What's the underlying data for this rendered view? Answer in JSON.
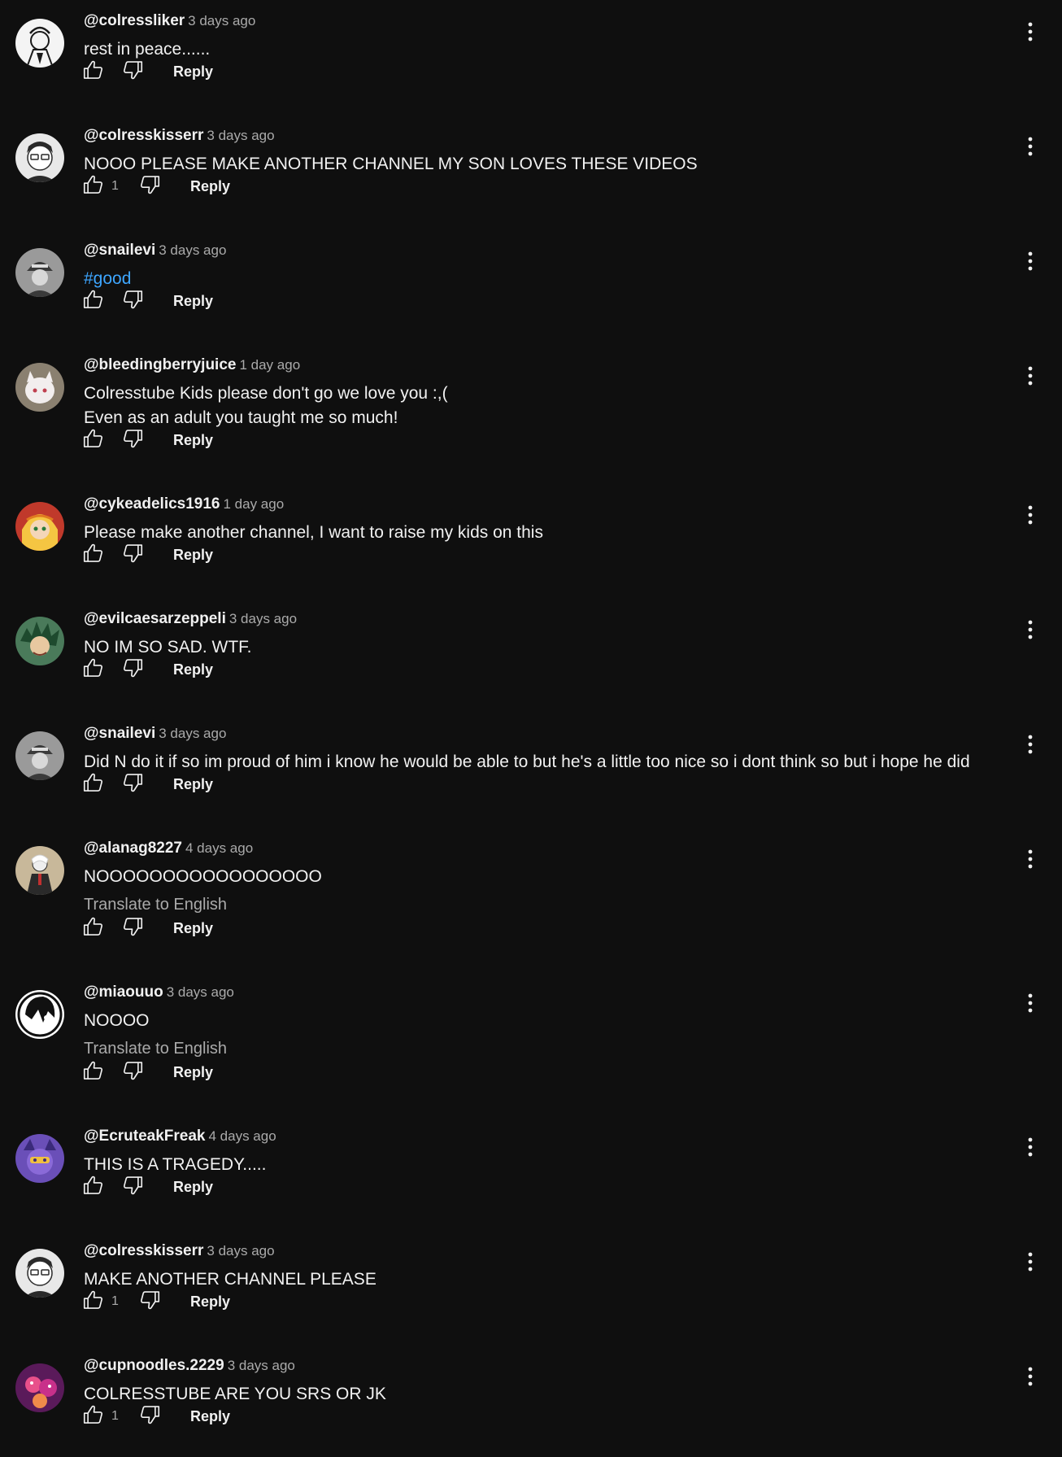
{
  "icons": {
    "like": "thumbs-up-icon",
    "dislike": "thumbs-down-icon",
    "menu": "more-vertical-icon"
  },
  "colors": {
    "background": "#0f0f0f",
    "text": "#f1f1f1",
    "secondary_text": "#aaaaaa",
    "hashtag": "#3ea6ff"
  },
  "comments": [
    {
      "author": "@colressliker",
      "time": "3 days ago",
      "lines": [
        "rest in peace......"
      ],
      "likes": "",
      "reply": "Reply",
      "avatar": {
        "bg": "#f4f4f4",
        "fg": "#1a1a1a",
        "style": "sketch"
      }
    },
    {
      "author": "@colresskisserr",
      "time": "3 days ago",
      "lines": [
        "NOOO PLEASE MAKE ANOTHER CHANNEL MY SON LOVES THESE VIDEOS"
      ],
      "likes": "1",
      "reply": "Reply",
      "avatar": {
        "bg": "#e8e8e8",
        "fg": "#2a2a2a",
        "style": "glasses"
      }
    },
    {
      "author": "@snailevi",
      "time": "3 days ago",
      "lines": [
        "#good"
      ],
      "hashtag": true,
      "likes": "",
      "reply": "Reply",
      "avatar": {
        "bg": "#9a9a9a",
        "fg": "#3a3a3a",
        "style": "cap"
      }
    },
    {
      "author": "@bleedingberryjuice",
      "time": "1 day ago",
      "lines": [
        "Colresstube Kids please don't go we love you :,(",
        "Even as an adult you taught me so much!"
      ],
      "likes": "",
      "reply": "Reply",
      "avatar": {
        "bg": "#8a8070",
        "fg": "#f2eeee",
        "style": "creature"
      }
    },
    {
      "author": "@cykeadelics1916",
      "time": "1 day ago",
      "lines": [
        "Please make another channel, I want to raise my kids on this"
      ],
      "likes": "",
      "reply": "Reply",
      "avatar": {
        "bg": "#c0392b",
        "fg": "#f5c542",
        "style": "anime"
      }
    },
    {
      "author": "@evilcaesarzeppeli",
      "time": "3 days ago",
      "lines": [
        "NO IM SO SAD. WTF."
      ],
      "likes": "",
      "reply": "Reply",
      "avatar": {
        "bg": "#4a7a5a",
        "fg": "#d8e0c0",
        "style": "spiky"
      }
    },
    {
      "author": "@snailevi",
      "time": "3 days ago",
      "lines": [
        "Did N do it if so im proud of him i know he would be able to but he's a little too nice so i dont think so but i hope he did"
      ],
      "likes": "",
      "reply": "Reply",
      "avatar": {
        "bg": "#9a9a9a",
        "fg": "#3a3a3a",
        "style": "cap"
      }
    },
    {
      "author": "@alanag8227",
      "time": "4 days ago",
      "lines": [
        "NOOOOOOOOOOOOOOOOO"
      ],
      "translate": "Translate to English",
      "likes": "",
      "reply": "Reply",
      "avatar": {
        "bg": "#c8b89a",
        "fg": "#2a2a2a",
        "style": "figure"
      }
    },
    {
      "author": "@miaouuo",
      "time": "3 days ago",
      "lines": [
        "NOOOO"
      ],
      "translate": "Translate to English",
      "likes": "",
      "reply": "Reply",
      "avatar": {
        "bg": "#ffffff",
        "fg": "#111111",
        "style": "hair"
      }
    },
    {
      "author": "@EcruteakFreak",
      "time": "4 days ago",
      "lines": [
        "THIS IS A TRAGEDY....."
      ],
      "likes": "",
      "reply": "Reply",
      "avatar": {
        "bg": "#6a4fb8",
        "fg": "#f0c040",
        "style": "mask"
      }
    },
    {
      "author": "@colresskisserr",
      "time": "3 days ago",
      "lines": [
        "MAKE ANOTHER CHANNEL PLEASE"
      ],
      "likes": "1",
      "reply": "Reply",
      "avatar": {
        "bg": "#e8e8e8",
        "fg": "#2a2a2a",
        "style": "glasses"
      }
    },
    {
      "author": "@cupnoodles.2229",
      "time": "3 days ago",
      "lines": [
        "COLRESSTUBE ARE YOU SRS OR JK"
      ],
      "likes": "1",
      "reply": "Reply",
      "avatar": {
        "bg": "#5a1a5a",
        "fg": "#e8508a",
        "style": "pink"
      }
    }
  ]
}
